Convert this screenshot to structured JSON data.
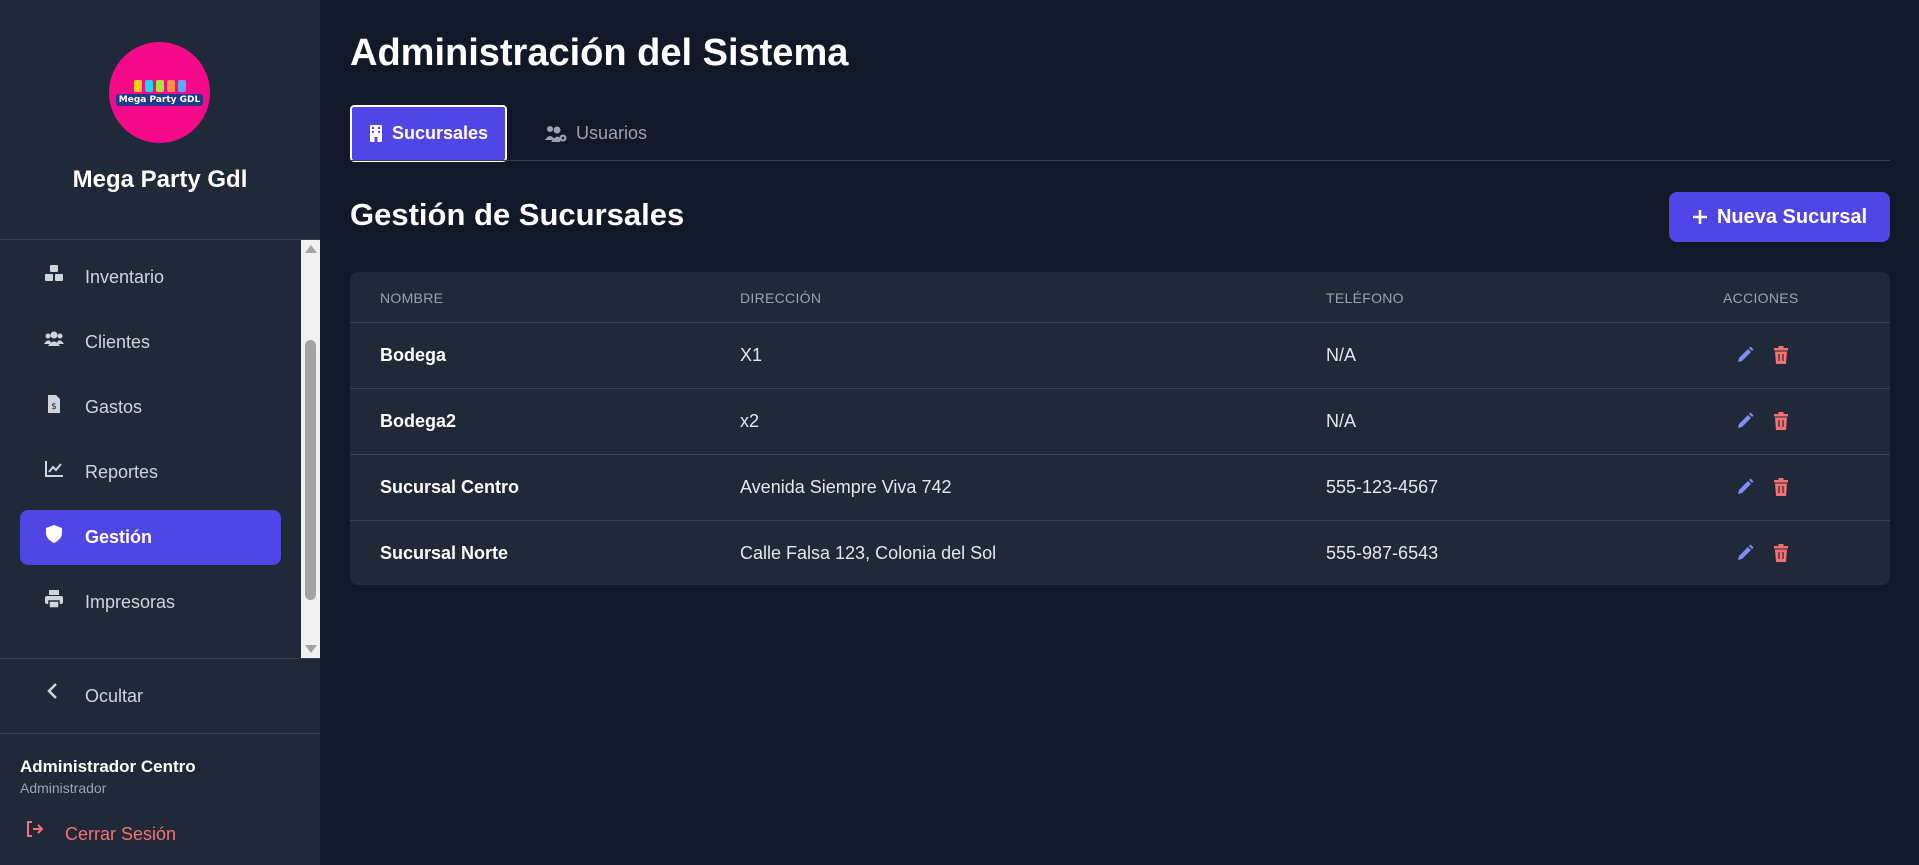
{
  "colors": {
    "accent": "#4f46e5",
    "sidebar_bg": "#1f2937",
    "page_bg": "#111827",
    "danger": "#f87171",
    "edit_icon": "#818cf8",
    "logo_bg": "#f50a8a"
  },
  "sidebar": {
    "logo_text": "Mega Party GDL",
    "brand": "Mega Party Gdl",
    "items": [
      {
        "label": "Inventario",
        "icon": "boxes-icon"
      },
      {
        "label": "Clientes",
        "icon": "users-icon"
      },
      {
        "label": "Gastos",
        "icon": "invoice-dollar-icon"
      },
      {
        "label": "Reportes",
        "icon": "chart-line-icon"
      },
      {
        "label": "Gestión",
        "icon": "shield-icon",
        "active": true
      },
      {
        "label": "Impresoras",
        "icon": "printer-icon"
      }
    ],
    "hide_label": "Ocultar",
    "user": {
      "name": "Administrador Centro",
      "role": "Administrador"
    },
    "logout_label": "Cerrar Sesión"
  },
  "main": {
    "title": "Administración del Sistema",
    "tabs": [
      {
        "label": "Sucursales",
        "icon": "building-icon",
        "active": true
      },
      {
        "label": "Usuarios",
        "icon": "users-cog-icon",
        "active": false
      }
    ],
    "section_title": "Gestión de Sucursales",
    "new_button": "Nueva Sucursal",
    "table": {
      "headers": [
        "NOMBRE",
        "DIRECCIÓN",
        "TELÉFONO",
        "ACCIONES"
      ],
      "rows": [
        {
          "nombre": "Bodega",
          "direccion": "X1",
          "telefono": "N/A"
        },
        {
          "nombre": "Bodega2",
          "direccion": "x2",
          "telefono": "N/A"
        },
        {
          "nombre": "Sucursal Centro",
          "direccion": "Avenida Siempre Viva 742",
          "telefono": "555-123-4567"
        },
        {
          "nombre": "Sucursal Norte",
          "direccion": "Calle Falsa 123, Colonia del Sol",
          "telefono": "555-987-6543"
        }
      ]
    }
  }
}
